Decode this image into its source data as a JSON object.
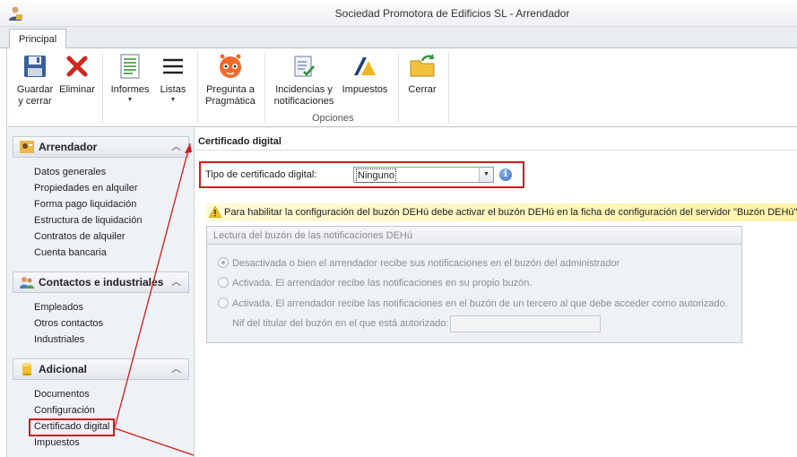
{
  "window": {
    "title": "Sociedad Promotora de Edificios SL - Arrendador"
  },
  "tabs": [
    {
      "label": "Principal"
    }
  ],
  "ribbon": {
    "buttons": [
      {
        "label": "Guardar\ny cerrar",
        "icon": "save-icon"
      },
      {
        "label": "Eliminar",
        "icon": "delete-x-icon"
      },
      {
        "label": "Informes",
        "icon": "report-icon"
      },
      {
        "label": "Listas",
        "icon": "list-icon"
      },
      {
        "label": "Pregunta a\nPragmática",
        "icon": "robot-icon"
      },
      {
        "label": "Incidencias y\nnotificaciones",
        "icon": "checklist-icon"
      },
      {
        "label": "Impuestos",
        "icon": "tax-agency-icon"
      },
      {
        "label": "Cerrar",
        "icon": "folder-close-icon"
      }
    ],
    "group_label": "Opciones"
  },
  "sidebar": {
    "sections": [
      {
        "title": "Arrendador",
        "icon": "user-id-icon",
        "items": [
          "Datos generales",
          "Propiedades en alquiler",
          "Forma pago liquidación",
          "Estructura de liquidación",
          "Contratos de alquiler",
          "Cuenta bancaria"
        ]
      },
      {
        "title": "Contactos e industriales",
        "icon": "contacts-icon",
        "items": [
          "Empleados",
          "Otros contactos",
          "Industriales"
        ]
      },
      {
        "title": "Adicional",
        "icon": "cylinder-icon",
        "items": [
          "Documentos",
          "Configuración",
          "Certificado digital",
          "Impuestos"
        ]
      }
    ]
  },
  "main": {
    "header": "Certificado  digital",
    "cert_type_label": "Tipo de certificado digital:",
    "cert_type_value": "Ninguno",
    "warning": "Para habilitar la configuración del buzón DEHú debe activar el buzón DEHú en la ficha de configuración del servidor \"Buzón DEHú\"",
    "groupbox": {
      "title": "Lectura del buzón de las notificaciones DEHú",
      "options": [
        {
          "label": "Desactivada o bien el arrendador recibe sus notificaciones en el buzón del administrador",
          "selected": true
        },
        {
          "label": "Activada. El arrendador recibe las notificaciones en su propio buzón.",
          "selected": false
        },
        {
          "label": "Activada. El arrendador recibe las notificaciones en el buzón de un tercero al que debe acceder como autorizado.",
          "selected": false
        }
      ],
      "nif_label": "Nif del titular del buzón en el que está autorizado:",
      "nif_value": ""
    }
  },
  "colors": {
    "highlight": "#d11a1a",
    "warning_bg": "#fdf3a8"
  }
}
